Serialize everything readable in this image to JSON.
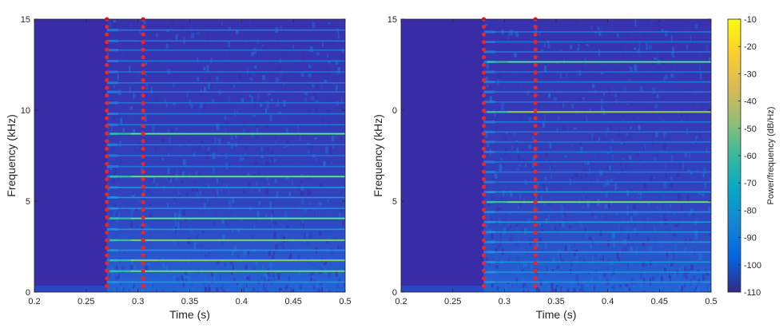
{
  "chart_data": [
    {
      "type": "heatmap",
      "subtype": "spectrogram",
      "xlabel": "Time (s)",
      "ylabel": "Frequency (kHz)",
      "xlim": [
        0.2,
        0.5
      ],
      "ylim": [
        0,
        15
      ],
      "xticks": [
        0.2,
        0.25,
        0.3,
        0.35,
        0.4,
        0.45,
        0.5
      ],
      "xtick_labels": [
        "0.2",
        "0.25",
        "0.3",
        "0.35",
        "0.4",
        "0.45",
        "0.5"
      ],
      "yticks": [
        0,
        5,
        10,
        15
      ],
      "ytick_labels": [
        "0",
        "5",
        "10",
        "15"
      ],
      "onset_s": 0.27,
      "markers_s": [
        0.27,
        0.305
      ],
      "harmonics_khz": [
        0.55,
        1.15,
        1.75,
        2.3,
        2.85,
        3.45,
        4.05,
        4.6,
        5.2,
        5.75,
        6.35,
        6.9,
        7.5,
        8.1,
        8.7,
        9.2,
        9.8,
        10.4,
        11.0,
        11.5,
        12.1,
        12.7,
        13.3,
        13.8,
        14.4
      ],
      "strong_harmonics_khz": [
        1.15,
        1.75,
        2.85,
        4.05,
        6.35,
        8.7
      ],
      "background_db": -110,
      "colormap": "parula"
    },
    {
      "type": "heatmap",
      "subtype": "spectrogram",
      "xlabel": "Time (s)",
      "ylabel": "Frequency (kHz)",
      "xlim": [
        0.2,
        0.5
      ],
      "ylim": [
        0,
        15
      ],
      "xticks": [
        0.2,
        0.25,
        0.3,
        0.35,
        0.4,
        0.45,
        0.5
      ],
      "xtick_labels": [
        "0.2",
        "0.25",
        "0.3",
        "0.35",
        "0.4",
        "0.45",
        "0.5"
      ],
      "yticks": [
        0,
        5,
        10,
        15
      ],
      "ytick_labels": [
        "0",
        "5",
        "0",
        "15"
      ],
      "onset_s": 0.28,
      "markers_s": [
        0.28,
        0.33
      ],
      "harmonics_khz": [
        0.55,
        1.1,
        1.65,
        2.2,
        2.75,
        3.3,
        3.85,
        4.4,
        4.95,
        5.5,
        6.05,
        6.6,
        7.15,
        7.7,
        8.25,
        8.8,
        9.35,
        9.9,
        10.45,
        11.0,
        11.55,
        12.1,
        12.65,
        13.2,
        13.75,
        14.3
      ],
      "strong_harmonics_khz": [
        4.95,
        9.9,
        12.65
      ],
      "background_db": -110,
      "colormap": "parula"
    }
  ],
  "colorbar": {
    "label": "Power/frequency (dB/Hz)",
    "range": [
      -110,
      -10
    ],
    "ticks": [
      -10,
      -20,
      -30,
      -40,
      -50,
      -60,
      -70,
      -80,
      -90,
      -100,
      -110
    ],
    "tick_labels": [
      "-10",
      "-20",
      "-30",
      "-40",
      "-50",
      "-60",
      "-70",
      "-80",
      "-90",
      "-100",
      "-110"
    ],
    "colors": [
      "#352a87",
      "#0363e1",
      "#1485d4",
      "#06a7c6",
      "#38b99e",
      "#92bf73",
      "#d9ba56",
      "#fcce2e",
      "#f9fb0e"
    ]
  },
  "marker_color": "#e8262a"
}
